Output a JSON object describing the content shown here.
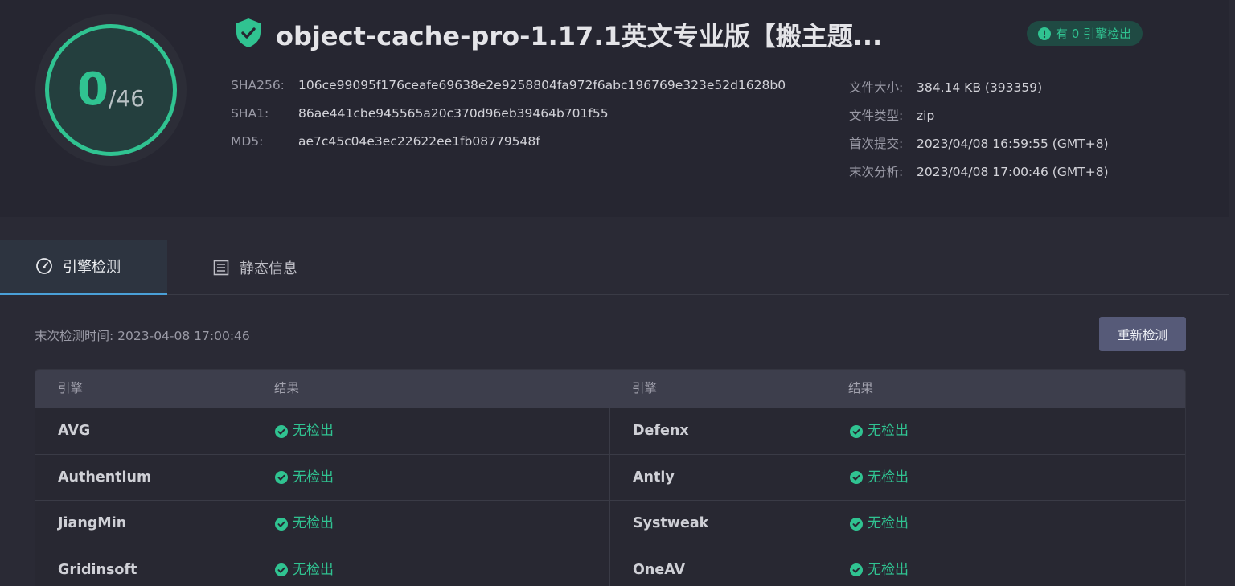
{
  "score": {
    "detected": "0",
    "total": "/46"
  },
  "file": {
    "title": "object-cache-pro-1.17.1英文专业版【搬主题...",
    "badge": "有 0 引擎检出"
  },
  "hashes": [
    {
      "label": "SHA256:",
      "value": "106ce99095f176ceafe69638e2e9258804fa972f6abc196769e323e52d1628b0"
    },
    {
      "label": "SHA1:",
      "value": "86ae441cbe945565a20c370d96eb39464b701f55"
    },
    {
      "label": "MD5:",
      "value": "ae7c45c04e3ec22622ee1fb08779548f"
    }
  ],
  "meta": [
    {
      "label": "文件大小:",
      "value": "384.14 KB (393359)"
    },
    {
      "label": "文件类型:",
      "value": "zip"
    },
    {
      "label": "首次提交:",
      "value": "2023/04/08 16:59:55 (GMT+8)"
    },
    {
      "label": "末次分析:",
      "value": "2023/04/08 17:00:46 (GMT+8)"
    }
  ],
  "tabs": [
    {
      "label": "引擎检测",
      "active": true
    },
    {
      "label": "静态信息",
      "active": false
    }
  ],
  "scan": {
    "time_label": "末次检测时间: 2023-04-08 17:00:46",
    "rescan_label": "重新检测"
  },
  "table": {
    "headers": [
      "引擎",
      "结果",
      "引擎",
      "结果"
    ],
    "rows": [
      {
        "left": {
          "engine": "AVG",
          "result": "无检出"
        },
        "right": {
          "engine": "Defenx",
          "result": "无检出"
        }
      },
      {
        "left": {
          "engine": "Authentium",
          "result": "无检出"
        },
        "right": {
          "engine": "Antiy",
          "result": "无检出"
        }
      },
      {
        "left": {
          "engine": "JiangMin",
          "result": "无检出"
        },
        "right": {
          "engine": "Systweak",
          "result": "无检出"
        }
      },
      {
        "left": {
          "engine": "Gridinsoft",
          "result": "无检出"
        },
        "right": {
          "engine": "OneAV",
          "result": "无检出"
        }
      }
    ]
  },
  "colors": {
    "accent": "#30c391",
    "tab_indicator": "#4aa0d8",
    "button": "#565a78"
  }
}
